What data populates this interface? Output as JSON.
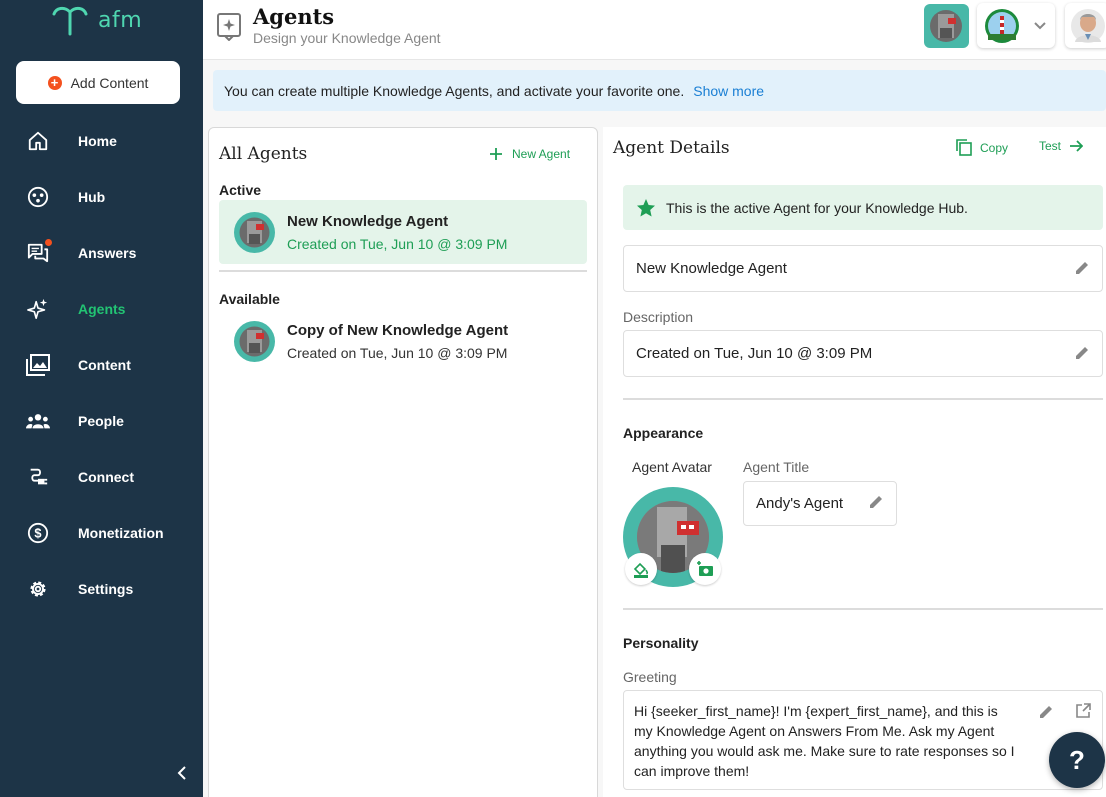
{
  "app": {
    "logo_text": "afm"
  },
  "sidebar": {
    "add_content_label": "Add Content",
    "items": [
      {
        "label": "Home",
        "icon": "home-icon"
      },
      {
        "label": "Hub",
        "icon": "hub-icon"
      },
      {
        "label": "Answers",
        "icon": "answers-icon"
      },
      {
        "label": "Agents",
        "icon": "sparkle-icon"
      },
      {
        "label": "Content",
        "icon": "images-icon"
      },
      {
        "label": "People",
        "icon": "people-icon"
      },
      {
        "label": "Connect",
        "icon": "connect-icon"
      },
      {
        "label": "Monetization",
        "icon": "dollar-icon"
      },
      {
        "label": "Settings",
        "icon": "gear-icon"
      }
    ],
    "active_item": "Agents"
  },
  "header": {
    "title": "Agents",
    "subtitle": "Design your Knowledge Agent"
  },
  "banner": {
    "text": "You can create multiple Knowledge Agents, and activate your favorite one.",
    "link": "Show more"
  },
  "list": {
    "title": "All Agents",
    "new_agent_label": "New Agent",
    "active_heading": "Active",
    "available_heading": "Available",
    "active_agents": [
      {
        "name": "New Knowledge Agent",
        "created": "Created on Tue, Jun 10 @ 3:09 PM"
      }
    ],
    "available_agents": [
      {
        "name": "Copy of New Knowledge Agent",
        "created": "Created on Tue, Jun 10 @ 3:09 PM"
      }
    ]
  },
  "details": {
    "title": "Agent Details",
    "copy_label": "Copy",
    "test_label": "Test",
    "active_note": "This is the active Agent for your Knowledge Hub.",
    "name_value": "New Knowledge Agent",
    "description_label": "Description",
    "description_value": "Created on Tue, Jun 10 @ 3:09 PM",
    "appearance_heading": "Appearance",
    "avatar_label": "Agent Avatar",
    "agent_title_label": "Agent Title",
    "agent_title_value": "Andy's Agent",
    "personality_heading": "Personality",
    "greeting_label": "Greeting",
    "greeting_value": "Hi {seeker_first_name}! I'm {expert_first_name}, and this is my Knowledge Agent on Answers From Me. Ask my Agent anything you would ask me. Make sure to rate responses so I can improve them!"
  },
  "help": {
    "label": "?"
  },
  "colors": {
    "sidebar_bg": "#1d3447",
    "accent_green": "#1e9e55",
    "brand_teal": "#4fd6b0",
    "notification": "#f4511e",
    "banner_bg": "#e2f1fb",
    "link_blue": "#1a7fd4"
  }
}
